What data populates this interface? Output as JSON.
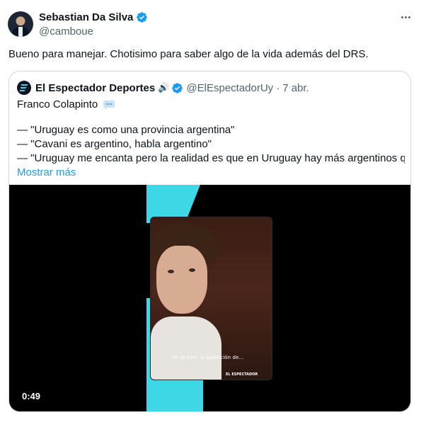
{
  "author": {
    "name": "Sebastian Da Silva",
    "handle": "@camboue",
    "verified_icon": "verified-badge-icon",
    "verified_color": "#1d9bf0"
  },
  "tweet": {
    "text": "Bueno para manejar. Chotisimo para saber algo de la vida además del DRS."
  },
  "quoted": {
    "name": "El Espectador Deportes",
    "audio_icon": "🔊",
    "handle": "@ElEspectadorUy",
    "separator": "·",
    "date": "7 abr.",
    "lines": [
      "Franco Colapinto",
      "— \"Uruguay es como una provincia argentina\"",
      "— \"Cavani es argentino, habla argentino\"",
      "— \"Uruguay me encanta pero la realidad es que en Uruguay hay más argentinos que..."
    ],
    "show_more": "Mostrar más",
    "link_color": "#1d9bf0",
    "accent_color": "#3ed7e6"
  },
  "video": {
    "caption": "no se bien la población de...",
    "brand": "EL ESPECTADOR",
    "duration": "0:49"
  }
}
